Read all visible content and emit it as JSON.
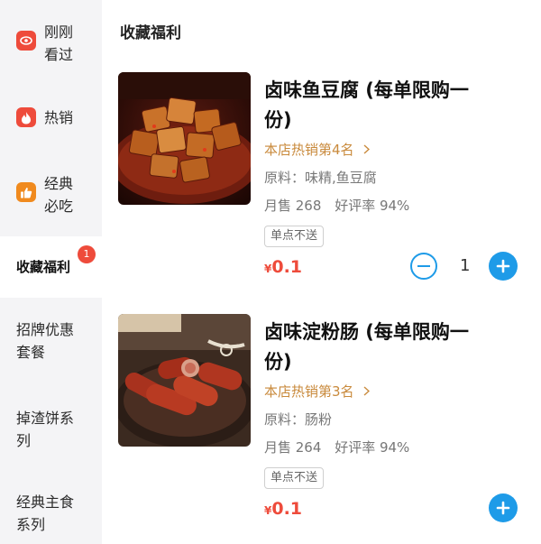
{
  "sidebar": {
    "items": [
      {
        "label_line1": "刚刚",
        "label_line2": "看过",
        "icon": "eye-icon",
        "icon_color": "#ee4b3b"
      },
      {
        "label_line1": "热销",
        "icon": "flame-icon",
        "icon_color": "#ee4b3b"
      },
      {
        "label_line1": "经典",
        "label_line2": "必吃",
        "icon": "thumbs-up-icon",
        "icon_color": "#f08a1e"
      },
      {
        "label_line1": "收藏福利",
        "badge": "1",
        "active": true
      },
      {
        "label_line1": "招牌优惠",
        "label_line2": "套餐"
      },
      {
        "label_line1": "掉渣饼系",
        "label_line2": "列"
      },
      {
        "label_line1": "经典主食",
        "label_line2": "系列"
      }
    ]
  },
  "main": {
    "section_title": "收藏福利",
    "products": [
      {
        "name_line1": "卤味鱼豆腐 (每单限购一",
        "name_line2": "份)",
        "rank": "本店热销第4名",
        "ingredients": "原料：味精,鱼豆腐",
        "monthly_sales": "月售 268",
        "rating": "好评率 94%",
        "tag": "单点不送",
        "currency": "¥",
        "price": "0.1",
        "quantity": "1",
        "image": "tofu-dish-photo"
      },
      {
        "name_line1": "卤味淀粉肠 (每单限购一",
        "name_line2": "份)",
        "rank": "本店热销第3名",
        "ingredients": "原料：肠粉",
        "monthly_sales": "月售 264",
        "rating": "好评率 94%",
        "tag": "单点不送",
        "currency": "¥",
        "price": "0.1",
        "image": "sausage-dish-photo"
      }
    ]
  },
  "colors": {
    "accent_blue": "#1e9be8",
    "price_red": "#ee4b3b",
    "rank_gold": "#c98a3c"
  }
}
